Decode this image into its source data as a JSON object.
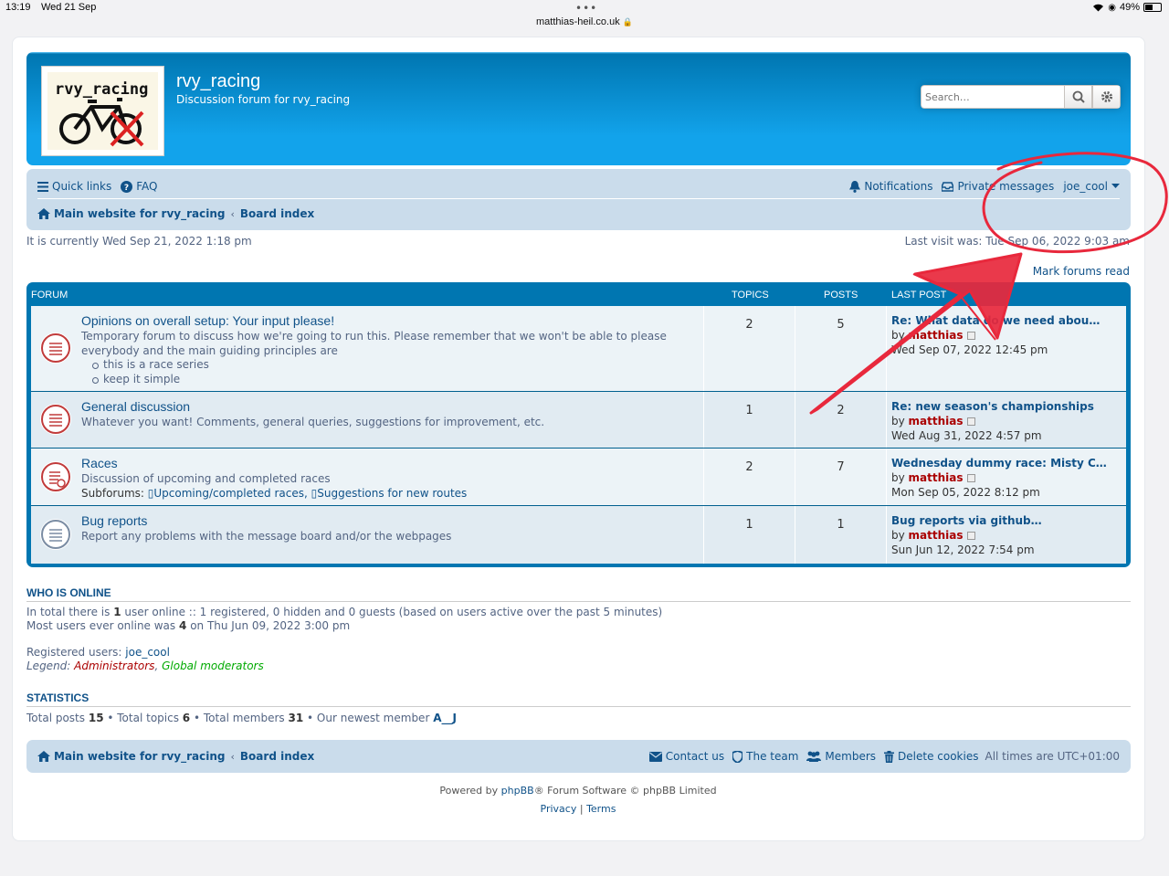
{
  "status_bar": {
    "time": "13:19",
    "date": "Wed 21 Sep",
    "url": "matthias-heil.co.uk",
    "battery": "49%"
  },
  "header": {
    "logo_text": "rvy_racing",
    "site_title": "rvy_racing",
    "site_description": "Discussion forum for rvy_racing",
    "search_placeholder": "Search…"
  },
  "navbar": {
    "quick_links": "Quick links",
    "faq": "FAQ",
    "notifications": "Notifications",
    "private_messages": "Private messages",
    "username": "joe_cool",
    "crumb_main": "Main website for rvy_racing",
    "crumb_board": "Board index"
  },
  "current_time": "It is currently Wed Sep 21, 2022 1:18 pm",
  "last_visit": "Last visit was: Tue Sep 06, 2022 9:03 am",
  "mark_read": "Mark forums read",
  "table_head": {
    "forum": "FORUM",
    "topics": "TOPICS",
    "posts": "POSTS",
    "last_post": "LAST POST"
  },
  "forums": [
    {
      "title": "Opinions on overall setup: Your input please!",
      "desc1": "Temporary forum to discuss how we're going to run this. Please remember that we won't be able to please",
      "desc2": "everybody and the main guiding principles are",
      "bullets": [
        "this is a race series",
        "keep it simple"
      ],
      "topics": "2",
      "posts": "5",
      "last_title": "Re: What data do we need abou…",
      "by": "by",
      "last_user": "matthias",
      "last_date": "Wed Sep 07, 2022 12:45 pm"
    },
    {
      "title": "General discussion",
      "desc1": "Whatever you want! Comments, general queries, suggestions for improvement, etc.",
      "topics": "1",
      "posts": "2",
      "last_title": "Re: new season's championships",
      "by": "by",
      "last_user": "matthias",
      "last_date": "Wed Aug 31, 2022 4:57 pm"
    },
    {
      "title": "Races",
      "desc1": "Discussion of upcoming and completed races",
      "subforums_label": "Subforums:",
      "subforum1": "Upcoming/completed races,",
      "subforum2": "Suggestions for new routes",
      "topics": "2",
      "posts": "7",
      "last_title": "Wednesday dummy race: Misty C…",
      "by": "by",
      "last_user": "matthias",
      "last_date": "Mon Sep 05, 2022 8:12 pm"
    },
    {
      "title": "Bug reports",
      "desc1": "Report any problems with the message board and/or the webpages",
      "topics": "1",
      "posts": "1",
      "last_title": "Bug reports via github…",
      "by": "by",
      "last_user": "matthias",
      "last_date": "Sun Jun 12, 2022 7:54 pm"
    }
  ],
  "who_online": {
    "title": "WHO IS ONLINE",
    "line1_a": "In total there is",
    "line1_n": "1",
    "line1_b": "user online :: 1 registered, 0 hidden and 0 guests (based on users active over the past 5 minutes)",
    "line2_a": "Most users ever online was",
    "line2_n": "4",
    "line2_b": "on Thu Jun 09, 2022 3:00 pm",
    "registered_label": "Registered users:",
    "registered_user": "joe_cool",
    "legend_label": "Legend:",
    "legend_admin": "Administrators",
    "legend_comma": ",",
    "legend_mod": "Global moderators"
  },
  "statistics": {
    "title": "STATISTICS",
    "posts_label": "Total posts",
    "posts": "15",
    "topics_label": "• Total topics",
    "topics": "6",
    "members_label": "• Total members",
    "members": "31",
    "newest_label": "• Our newest member",
    "newest": "A__J"
  },
  "footer_nav": {
    "crumb_main": "Main website for rvy_racing",
    "crumb_board": "Board index",
    "contact": "Contact us",
    "team": "The team",
    "members": "Members",
    "delete_cookies": "Delete cookies",
    "timezone": "All times are UTC+01:00"
  },
  "footer": {
    "powered_a": "Powered by",
    "phpbb": "phpBB",
    "powered_b": "® Forum Software © phpBB Limited",
    "privacy": "Privacy",
    "sep": "|",
    "terms": "Terms"
  },
  "colors": {
    "header_blue": "#12a3eb",
    "nav_bg": "#cadceb",
    "link": "#105289",
    "admin_red": "#aa0000",
    "mod_green": "#00aa00",
    "annotation_red": "#e8283c"
  }
}
